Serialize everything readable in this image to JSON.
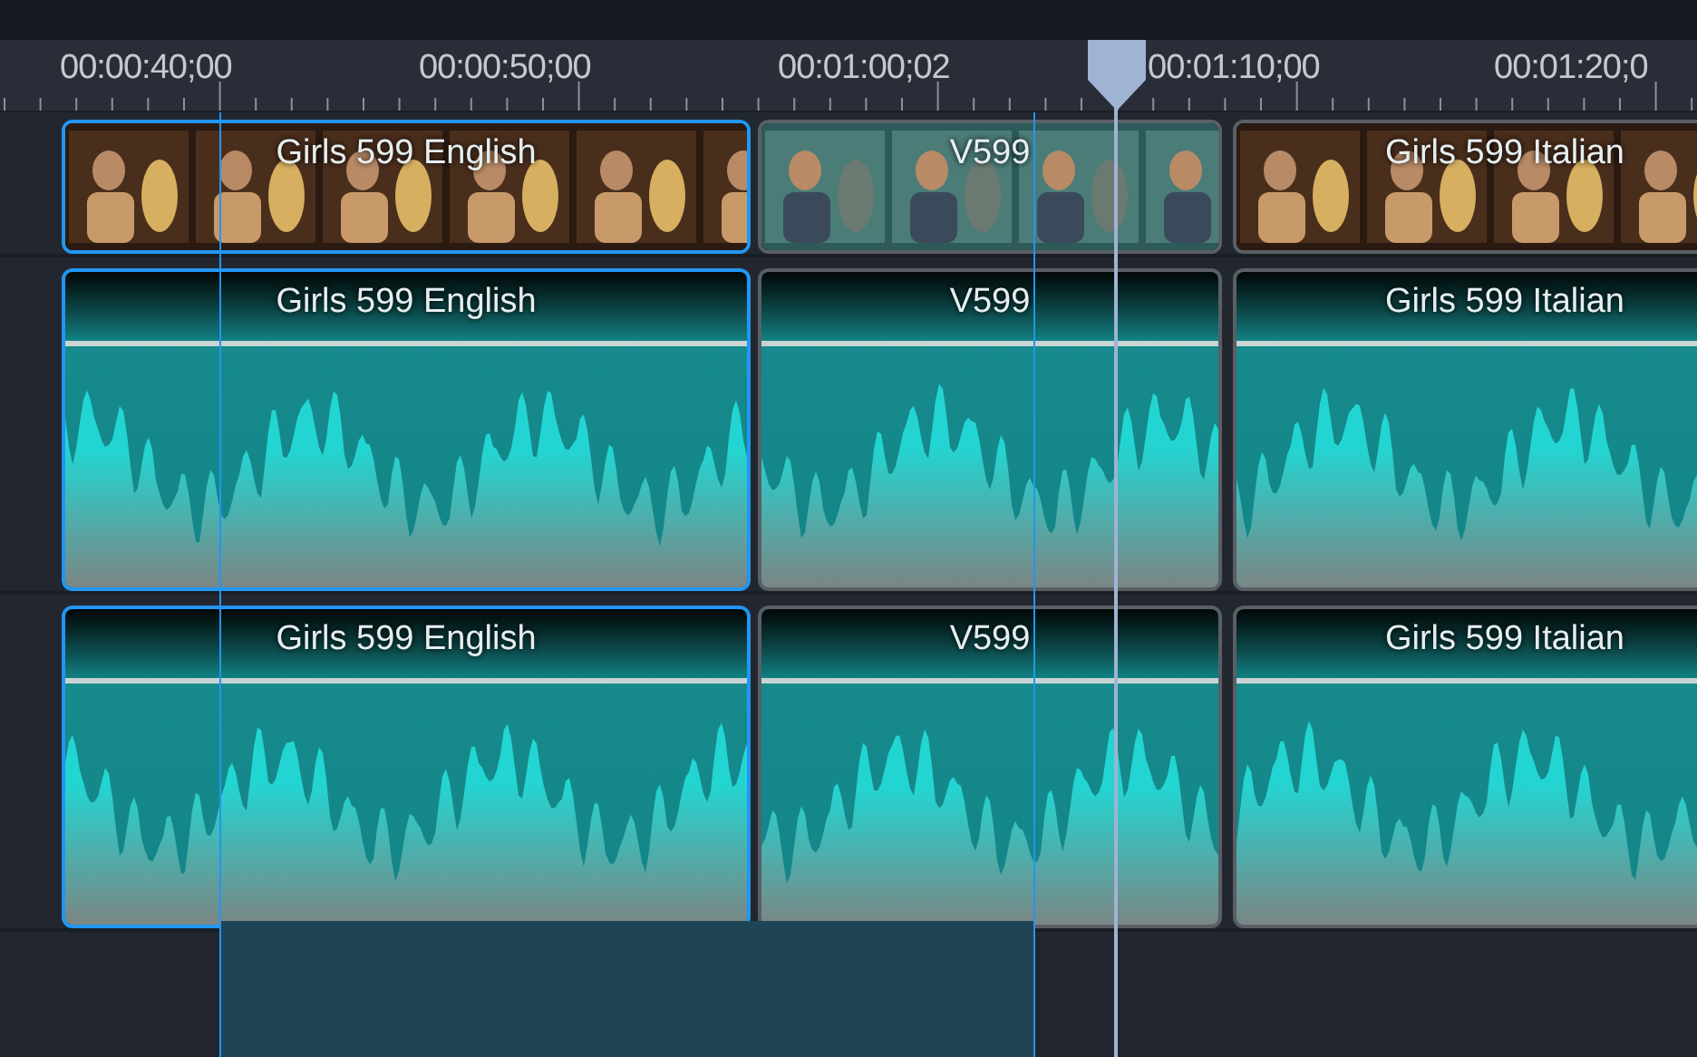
{
  "ruler": {
    "labels": [
      "00:00:40;00",
      "00:00:50;00",
      "00:01:00;02",
      "00:01:10;00",
      "00:01:20;0"
    ]
  },
  "tracks": [
    {
      "kind": "video",
      "clips": [
        {
          "label": "Girls 599 English",
          "selected": true
        },
        {
          "label": "V599",
          "selected": false
        },
        {
          "label": "Girls 599 Italian",
          "selected": false
        }
      ]
    },
    {
      "kind": "audio",
      "clips": [
        {
          "label": "Girls 599 English",
          "selected": true
        },
        {
          "label": "V599",
          "selected": false
        },
        {
          "label": "Girls 599 Italian",
          "selected": false
        }
      ]
    },
    {
      "kind": "audio",
      "clips": [
        {
          "label": "Girls 599 English",
          "selected": true
        },
        {
          "label": "V599",
          "selected": false
        },
        {
          "label": "Girls 599 Italian",
          "selected": false
        }
      ]
    }
  ]
}
